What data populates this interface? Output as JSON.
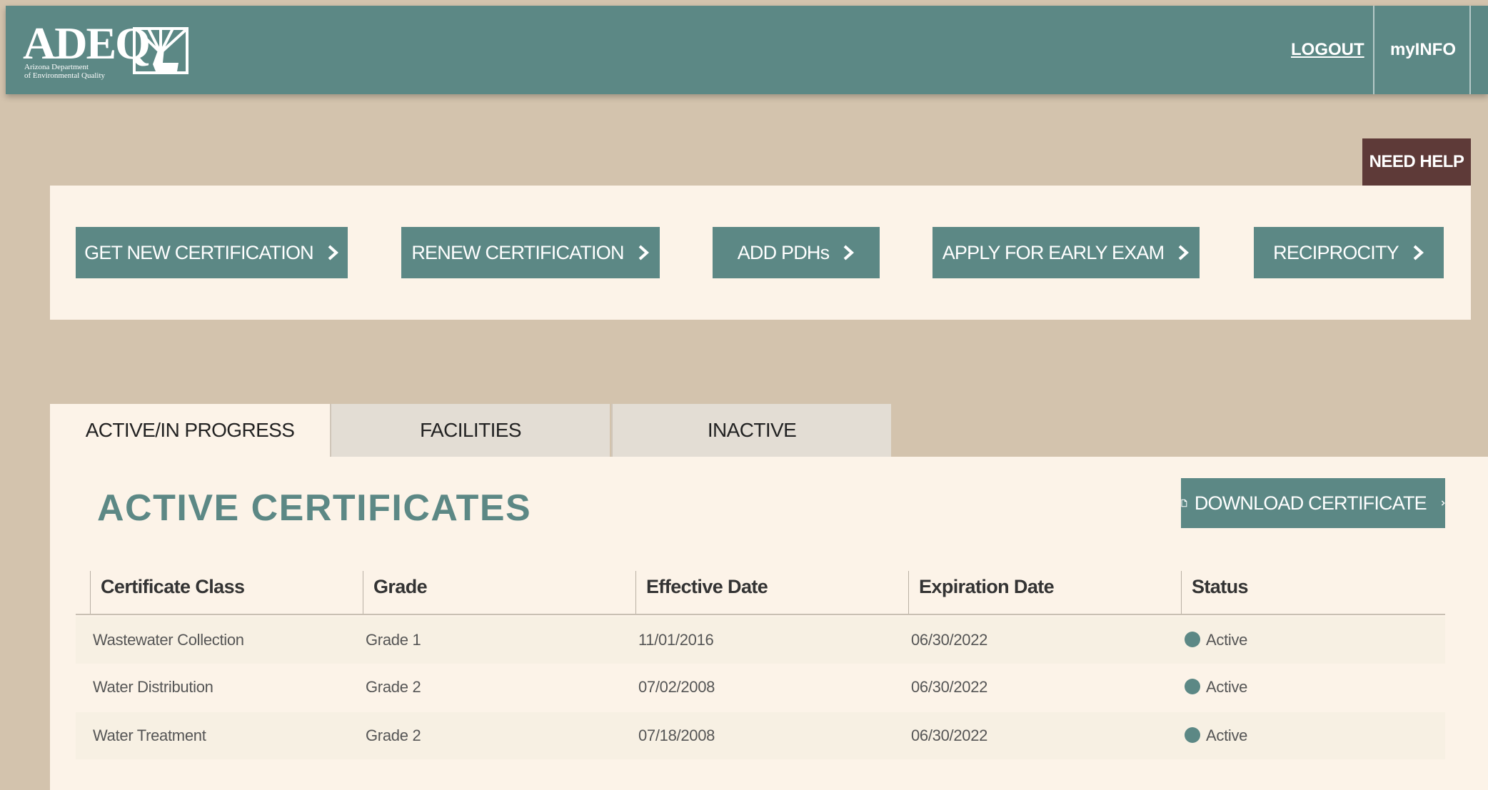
{
  "header": {
    "logo_text": "ADEQ",
    "logo_sub_line1": "Arizona Department",
    "logo_sub_line2": "of Environmental Quality",
    "logout_label": "LOGOUT",
    "myinfo_label": "myINFO"
  },
  "help": {
    "label": "NEED HELP ?"
  },
  "actions": {
    "items": [
      {
        "label": "GET NEW CERTIFICATION"
      },
      {
        "label": "RENEW CERTIFICATION"
      },
      {
        "label": "ADD PDHs"
      },
      {
        "label": "APPLY FOR EARLY EXAM"
      },
      {
        "label": "RECIPROCITY"
      }
    ]
  },
  "tabs": [
    {
      "label": "ACTIVE/IN PROGRESS",
      "selected": true
    },
    {
      "label": "FACILITIES",
      "selected": false
    },
    {
      "label": "INACTIVE",
      "selected": false
    }
  ],
  "certificates": {
    "title": "ACTIVE CERTIFICATES",
    "download_label": "DOWNLOAD CERTIFICATE",
    "columns": [
      "Certificate Class",
      "Grade",
      "Effective Date",
      "Expiration Date",
      "Status"
    ],
    "rows": [
      {
        "class": "Wastewater Collection",
        "grade": "Grade 1",
        "effective": "11/01/2016",
        "expiration": "06/30/2022",
        "status": "Active"
      },
      {
        "class": "Water Distribution",
        "grade": "Grade 2",
        "effective": "07/02/2008",
        "expiration": "06/30/2022",
        "status": "Active"
      },
      {
        "class": "Water Treatment",
        "grade": "Grade 2",
        "effective": "07/18/2008",
        "expiration": "06/30/2022",
        "status": "Active"
      }
    ]
  },
  "colors": {
    "teal": "#5c8885",
    "tan_background": "#d3c3ad",
    "panel": "#fcf3e8",
    "help_button": "#5e3a38"
  }
}
